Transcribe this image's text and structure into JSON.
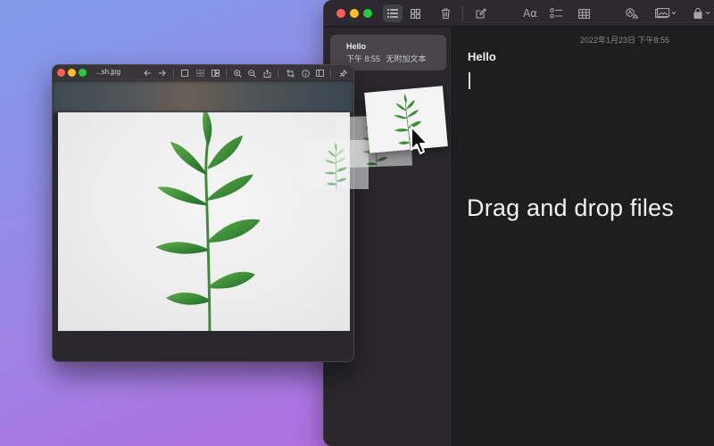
{
  "notes": {
    "list": [
      {
        "title": "Hello",
        "time": "下午 8:55",
        "snippet": "无附加文本"
      }
    ],
    "editor": {
      "date": "2022年1月23日 下午8:55",
      "heading": "Hello",
      "overlay_text": "Drag and drop files"
    },
    "toolbar": {
      "icons": [
        "list-view-icon",
        "gallery-view-icon",
        "trash-icon",
        "compose-icon",
        "format-icon",
        "checklist-icon",
        "table-icon",
        "collaborate-icon",
        "media-icon",
        "lock-icon"
      ],
      "format_label": "Aα"
    }
  },
  "preview": {
    "title": "...sh.jpg",
    "toolbar_icons": [
      "back-icon",
      "forward-icon",
      "sidebar-icon",
      "thumbnails-icon",
      "contact-sheet-icon",
      "zoom-in-icon",
      "zoom-out-icon",
      "share-icon",
      "crop-icon",
      "info-icon",
      "inspector-icon",
      "pin-icon"
    ]
  },
  "colors": {
    "background_start": "#7f9be8",
    "background_end": "#c46ad8",
    "traffic_red": "#fe5f57",
    "traffic_yellow": "#febc2e",
    "traffic_green": "#28c840",
    "leaf_green": "#2e7d32"
  }
}
